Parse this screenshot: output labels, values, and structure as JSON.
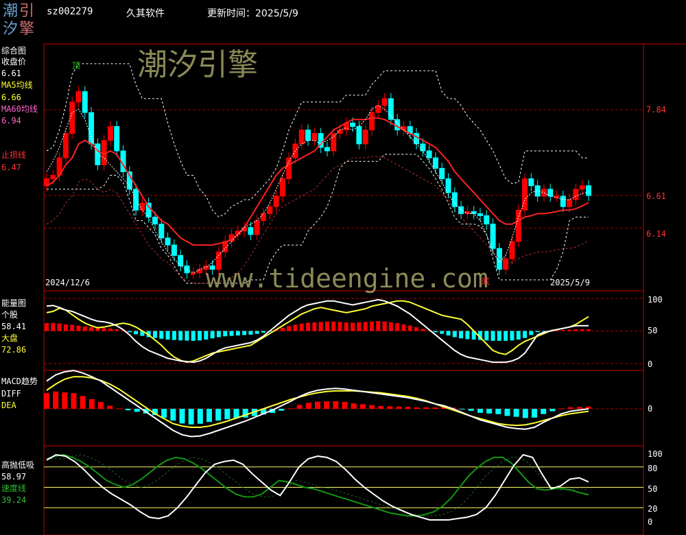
{
  "header": {
    "logo_chars": [
      "潮",
      "引",
      "汐",
      "擎"
    ],
    "code": "sz002279",
    "name": "久其软件",
    "update_label": "更新时间：2025/5/9"
  },
  "watermark": {
    "cn": "潮汐引擎",
    "url": "www.tideengine.com"
  },
  "colors": {
    "up": "#ff0000",
    "down": "#00ffff",
    "ma5": "#ffff00",
    "ma60": "#ff3333",
    "stop": "#ff0000",
    "grid": "#aa0000",
    "white": "#ffffff",
    "yellow": "#ffff33",
    "green": "#119911",
    "dash": "#bb3333"
  },
  "panels": {
    "main": {
      "title": "综合图",
      "close_label": "收盘价",
      "close_value": "6.61",
      "ma5_label": "MA5均线",
      "ma5_value": "6.66",
      "ma60_label": "MA60均线",
      "ma60_value": "6.94",
      "stop_label": "止损线",
      "stop_value": "6.47",
      "peak_mark": "顶",
      "bottom_mark": "底",
      "date_start": "2024/12/6",
      "date_end": "2025/5/9",
      "ticks": [
        "7.84",
        "6.61",
        "6.14"
      ]
    },
    "energy": {
      "title": "能量图",
      "stock_label": "个股",
      "stock_value": "58.41",
      "market_label": "大盘",
      "market_value": "72.86",
      "ticks": [
        "100",
        "50",
        "0"
      ]
    },
    "macd": {
      "title": "MACD趋势",
      "diff_label": "DIFF",
      "dea_label": "DEA",
      "ticks": [
        "0"
      ]
    },
    "absorb": {
      "title": "高抛低吸",
      "value": "58.97",
      "speed_label": "速度线",
      "speed_value": "39.24",
      "ticks": [
        "100",
        "80",
        "50",
        "20",
        "0"
      ]
    }
  },
  "chart_data": [
    {
      "type": "candlestick",
      "panel": "综合图",
      "x_range": [
        "2024/12/6",
        "2025/5/9"
      ],
      "price_ticks": [
        7.84,
        6.61,
        6.14
      ],
      "close": [
        6.85,
        6.9,
        7.15,
        7.5,
        7.95,
        8.1,
        7.8,
        7.35,
        7.05,
        7.4,
        7.6,
        7.25,
        6.95,
        6.7,
        6.4,
        6.5,
        6.3,
        6.2,
        6.0,
        5.9,
        5.75,
        5.6,
        5.5,
        5.5,
        5.55,
        5.6,
        5.55,
        5.8,
        5.95,
        6.05,
        6.1,
        6.15,
        6.05,
        6.25,
        6.35,
        6.45,
        6.6,
        6.85,
        7.15,
        7.35,
        7.55,
        7.4,
        7.5,
        7.3,
        7.25,
        7.5,
        7.55,
        7.65,
        7.6,
        7.35,
        7.55,
        7.8,
        7.9,
        8.0,
        7.7,
        7.55,
        7.6,
        7.5,
        7.35,
        7.25,
        7.15,
        7.0,
        6.85,
        6.65,
        6.45,
        6.35,
        6.38,
        6.35,
        6.32,
        6.2,
        5.85,
        5.55,
        5.7,
        5.95,
        6.4,
        6.85,
        6.75,
        6.6,
        6.7,
        6.6,
        6.6,
        6.45,
        6.55,
        6.7,
        6.75,
        6.61
      ],
      "ma5": [
        6.95,
        7.1,
        7.3,
        7.55,
        7.8,
        7.85,
        7.7,
        7.45,
        7.2,
        7.15,
        7.05,
        6.95,
        6.85,
        6.75,
        6.55,
        6.4,
        6.3,
        6.1,
        5.95,
        5.8,
        5.7,
        5.6,
        5.55,
        5.5,
        5.55,
        5.58,
        5.65,
        5.75,
        5.85,
        5.95,
        6.05,
        6.15,
        6.2,
        6.25,
        6.35,
        6.5,
        6.7,
        6.9,
        7.1,
        7.25,
        7.35,
        7.4,
        7.4,
        7.35,
        7.4,
        7.45,
        7.55,
        7.58,
        7.55,
        7.6,
        7.7,
        7.85,
        7.9,
        7.85,
        7.75,
        7.65,
        7.55,
        7.45,
        7.35,
        7.25,
        7.1,
        6.95,
        6.8,
        6.62,
        6.5,
        6.4,
        6.35,
        6.35,
        6.25,
        6.05,
        5.8,
        5.65,
        5.75,
        6.0,
        6.3,
        6.55,
        6.65,
        6.68,
        6.65,
        6.6,
        6.58,
        6.55,
        6.55,
        6.6,
        6.64,
        6.66
      ],
      "ma60": [
        6.75,
        6.8,
        6.9,
        7.05,
        7.15,
        7.35,
        7.4,
        7.35,
        7.25,
        7.2,
        7.25,
        7.2,
        7.05,
        6.9,
        6.75,
        6.6,
        6.45,
        6.35,
        6.25,
        6.2,
        6.1,
        6.0,
        5.95,
        5.9,
        5.9,
        5.9,
        5.9,
        5.92,
        5.94,
        5.98,
        6.05,
        6.15,
        6.3,
        6.45,
        6.6,
        6.75,
        6.9,
        7.0,
        7.05,
        7.1,
        7.15,
        7.2,
        7.25,
        7.35,
        7.45,
        7.55,
        7.6,
        7.65,
        7.7,
        7.7,
        7.7,
        7.72,
        7.72,
        7.7,
        7.65,
        7.6,
        7.55,
        7.5,
        7.45,
        7.4,
        7.35,
        7.3,
        7.2,
        7.1,
        6.95,
        6.85,
        6.75,
        6.65,
        6.55,
        6.45,
        6.35,
        6.25,
        6.2,
        6.2,
        6.25,
        6.3,
        6.32,
        6.35,
        6.35,
        6.36,
        6.38,
        6.4,
        6.4,
        6.42,
        6.46,
        6.51
      ]
    },
    {
      "type": "bar+line",
      "panel": "能量图",
      "ylim": [
        0,
        100
      ],
      "stock": [
        88,
        89,
        86,
        82,
        80,
        76,
        72,
        68,
        65,
        64,
        62,
        58,
        52,
        44,
        34,
        26,
        20,
        16,
        12,
        8,
        6,
        4,
        3,
        2,
        4,
        8,
        14,
        20,
        24,
        26,
        28,
        30,
        32,
        36,
        42,
        50,
        58,
        66,
        74,
        80,
        86,
        90,
        92,
        94,
        96,
        96,
        94,
        92,
        90,
        92,
        94,
        96,
        98,
        96,
        92,
        88,
        82,
        76,
        68,
        60,
        52,
        44,
        36,
        28,
        20,
        14,
        10,
        8,
        6,
        4,
        2,
        2,
        2,
        4,
        8,
        16,
        30,
        44,
        48,
        50,
        52,
        54,
        56,
        58,
        58,
        58
      ],
      "market": [
        78,
        80,
        85,
        82,
        75,
        68,
        62,
        58,
        55,
        56,
        58,
        60,
        62,
        60,
        56,
        50,
        44,
        36,
        28,
        18,
        10,
        5,
        2,
        4,
        8,
        12,
        16,
        18,
        20,
        22,
        24,
        26,
        28,
        34,
        40,
        46,
        52,
        58,
        64,
        70,
        76,
        80,
        84,
        86,
        84,
        82,
        80,
        78,
        80,
        82,
        84,
        88,
        90,
        92,
        94,
        96,
        96,
        94,
        90,
        86,
        82,
        78,
        74,
        72,
        70,
        68,
        60,
        50,
        40,
        30,
        20,
        16,
        14,
        20,
        28,
        34,
        38,
        42,
        46,
        50,
        52,
        54,
        56,
        60,
        66,
        72
      ]
    },
    {
      "type": "bar+line",
      "panel": "MACD趋势",
      "diff": [
        0.45,
        0.55,
        0.6,
        0.62,
        0.58,
        0.52,
        0.45,
        0.35,
        0.25,
        0.15,
        0.05,
        -0.05,
        -0.15,
        -0.25,
        -0.35,
        -0.42,
        -0.45,
        -0.44,
        -0.4,
        -0.35,
        -0.3,
        -0.25,
        -0.2,
        -0.14,
        -0.08,
        -0.02,
        0.05,
        0.12,
        0.2,
        0.26,
        0.3,
        0.32,
        0.33,
        0.32,
        0.3,
        0.28,
        0.26,
        0.24,
        0.22,
        0.2,
        0.18,
        0.15,
        0.12,
        0.08,
        0.05,
        0.0,
        -0.06,
        -0.12,
        -0.18,
        -0.22,
        -0.26,
        -0.3,
        -0.32,
        -0.33,
        -0.3,
        -0.22,
        -0.15,
        -0.08,
        -0.04,
        -0.02,
        0.0
      ],
      "dea": [
        0.3,
        0.4,
        0.48,
        0.52,
        0.52,
        0.5,
        0.46,
        0.4,
        0.32,
        0.22,
        0.12,
        0.02,
        -0.08,
        -0.16,
        -0.24,
        -0.28,
        -0.3,
        -0.3,
        -0.28,
        -0.24,
        -0.2,
        -0.15,
        -0.1,
        -0.05,
        0.0,
        0.05,
        0.1,
        0.15,
        0.19,
        0.23,
        0.26,
        0.28,
        0.29,
        0.29,
        0.29,
        0.28,
        0.27,
        0.26,
        0.24,
        0.22,
        0.2,
        0.17,
        0.13,
        0.08,
        0.03,
        -0.02,
        -0.07,
        -0.12,
        -0.16,
        -0.2,
        -0.24,
        -0.26,
        -0.27,
        -0.26,
        -0.23,
        -0.19,
        -0.15,
        -0.11,
        -0.08,
        -0.06,
        -0.04
      ]
    },
    {
      "type": "line",
      "panel": "高抛低吸",
      "ylim": [
        0,
        100
      ],
      "levels": [
        80,
        50,
        20
      ],
      "absorb": [
        90,
        98,
        96,
        88,
        76,
        62,
        50,
        40,
        32,
        24,
        14,
        6,
        4,
        8,
        20,
        36,
        54,
        72,
        84,
        88,
        90,
        84,
        70,
        58,
        46,
        38,
        58,
        80,
        92,
        96,
        94,
        88,
        76,
        62,
        50,
        40,
        30,
        22,
        16,
        10,
        6,
        2,
        2,
        2,
        4,
        6,
        10,
        20,
        38,
        60,
        82,
        98,
        94,
        70,
        48,
        52,
        62,
        64,
        58
      ],
      "speed": [
        92,
        96,
        98,
        94,
        88,
        80,
        70,
        60,
        54,
        50,
        54,
        62,
        72,
        82,
        90,
        94,
        92,
        86,
        78,
        68,
        58,
        48,
        40,
        36,
        36,
        40,
        50,
        60,
        58,
        54,
        50,
        48,
        44,
        40,
        36,
        32,
        28,
        24,
        20,
        16,
        12,
        10,
        8,
        8,
        10,
        14,
        22,
        34,
        50,
        66,
        78,
        88,
        94,
        94,
        86,
        72,
        58,
        48,
        46,
        48,
        48,
        46,
        42,
        39
      ]
    }
  ]
}
